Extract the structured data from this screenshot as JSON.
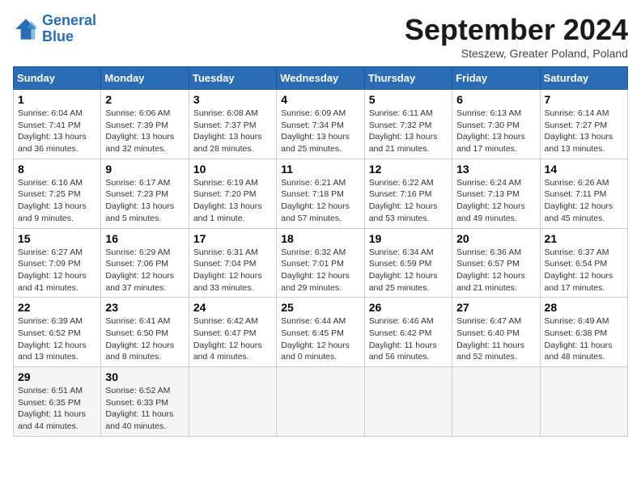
{
  "logo": {
    "line1": "General",
    "line2": "Blue"
  },
  "title": "September 2024",
  "subtitle": "Steszew, Greater Poland, Poland",
  "days_header": [
    "Sunday",
    "Monday",
    "Tuesday",
    "Wednesday",
    "Thursday",
    "Friday",
    "Saturday"
  ],
  "weeks": [
    [
      {
        "day": "1",
        "info": "Sunrise: 6:04 AM\nSunset: 7:41 PM\nDaylight: 13 hours and 36 minutes."
      },
      {
        "day": "2",
        "info": "Sunrise: 6:06 AM\nSunset: 7:39 PM\nDaylight: 13 hours and 32 minutes."
      },
      {
        "day": "3",
        "info": "Sunrise: 6:08 AM\nSunset: 7:37 PM\nDaylight: 13 hours and 28 minutes."
      },
      {
        "day": "4",
        "info": "Sunrise: 6:09 AM\nSunset: 7:34 PM\nDaylight: 13 hours and 25 minutes."
      },
      {
        "day": "5",
        "info": "Sunrise: 6:11 AM\nSunset: 7:32 PM\nDaylight: 13 hours and 21 minutes."
      },
      {
        "day": "6",
        "info": "Sunrise: 6:13 AM\nSunset: 7:30 PM\nDaylight: 13 hours and 17 minutes."
      },
      {
        "day": "7",
        "info": "Sunrise: 6:14 AM\nSunset: 7:27 PM\nDaylight: 13 hours and 13 minutes."
      }
    ],
    [
      {
        "day": "8",
        "info": "Sunrise: 6:16 AM\nSunset: 7:25 PM\nDaylight: 13 hours and 9 minutes."
      },
      {
        "day": "9",
        "info": "Sunrise: 6:17 AM\nSunset: 7:23 PM\nDaylight: 13 hours and 5 minutes."
      },
      {
        "day": "10",
        "info": "Sunrise: 6:19 AM\nSunset: 7:20 PM\nDaylight: 13 hours and 1 minute."
      },
      {
        "day": "11",
        "info": "Sunrise: 6:21 AM\nSunset: 7:18 PM\nDaylight: 12 hours and 57 minutes."
      },
      {
        "day": "12",
        "info": "Sunrise: 6:22 AM\nSunset: 7:16 PM\nDaylight: 12 hours and 53 minutes."
      },
      {
        "day": "13",
        "info": "Sunrise: 6:24 AM\nSunset: 7:13 PM\nDaylight: 12 hours and 49 minutes."
      },
      {
        "day": "14",
        "info": "Sunrise: 6:26 AM\nSunset: 7:11 PM\nDaylight: 12 hours and 45 minutes."
      }
    ],
    [
      {
        "day": "15",
        "info": "Sunrise: 6:27 AM\nSunset: 7:09 PM\nDaylight: 12 hours and 41 minutes."
      },
      {
        "day": "16",
        "info": "Sunrise: 6:29 AM\nSunset: 7:06 PM\nDaylight: 12 hours and 37 minutes."
      },
      {
        "day": "17",
        "info": "Sunrise: 6:31 AM\nSunset: 7:04 PM\nDaylight: 12 hours and 33 minutes."
      },
      {
        "day": "18",
        "info": "Sunrise: 6:32 AM\nSunset: 7:01 PM\nDaylight: 12 hours and 29 minutes."
      },
      {
        "day": "19",
        "info": "Sunrise: 6:34 AM\nSunset: 6:59 PM\nDaylight: 12 hours and 25 minutes."
      },
      {
        "day": "20",
        "info": "Sunrise: 6:36 AM\nSunset: 6:57 PM\nDaylight: 12 hours and 21 minutes."
      },
      {
        "day": "21",
        "info": "Sunrise: 6:37 AM\nSunset: 6:54 PM\nDaylight: 12 hours and 17 minutes."
      }
    ],
    [
      {
        "day": "22",
        "info": "Sunrise: 6:39 AM\nSunset: 6:52 PM\nDaylight: 12 hours and 13 minutes."
      },
      {
        "day": "23",
        "info": "Sunrise: 6:41 AM\nSunset: 6:50 PM\nDaylight: 12 hours and 8 minutes."
      },
      {
        "day": "24",
        "info": "Sunrise: 6:42 AM\nSunset: 6:47 PM\nDaylight: 12 hours and 4 minutes."
      },
      {
        "day": "25",
        "info": "Sunrise: 6:44 AM\nSunset: 6:45 PM\nDaylight: 12 hours and 0 minutes."
      },
      {
        "day": "26",
        "info": "Sunrise: 6:46 AM\nSunset: 6:42 PM\nDaylight: 11 hours and 56 minutes."
      },
      {
        "day": "27",
        "info": "Sunrise: 6:47 AM\nSunset: 6:40 PM\nDaylight: 11 hours and 52 minutes."
      },
      {
        "day": "28",
        "info": "Sunrise: 6:49 AM\nSunset: 6:38 PM\nDaylight: 11 hours and 48 minutes."
      }
    ],
    [
      {
        "day": "29",
        "info": "Sunrise: 6:51 AM\nSunset: 6:35 PM\nDaylight: 11 hours and 44 minutes."
      },
      {
        "day": "30",
        "info": "Sunrise: 6:52 AM\nSunset: 6:33 PM\nDaylight: 11 hours and 40 minutes."
      },
      {
        "day": "",
        "info": ""
      },
      {
        "day": "",
        "info": ""
      },
      {
        "day": "",
        "info": ""
      },
      {
        "day": "",
        "info": ""
      },
      {
        "day": "",
        "info": ""
      }
    ]
  ]
}
